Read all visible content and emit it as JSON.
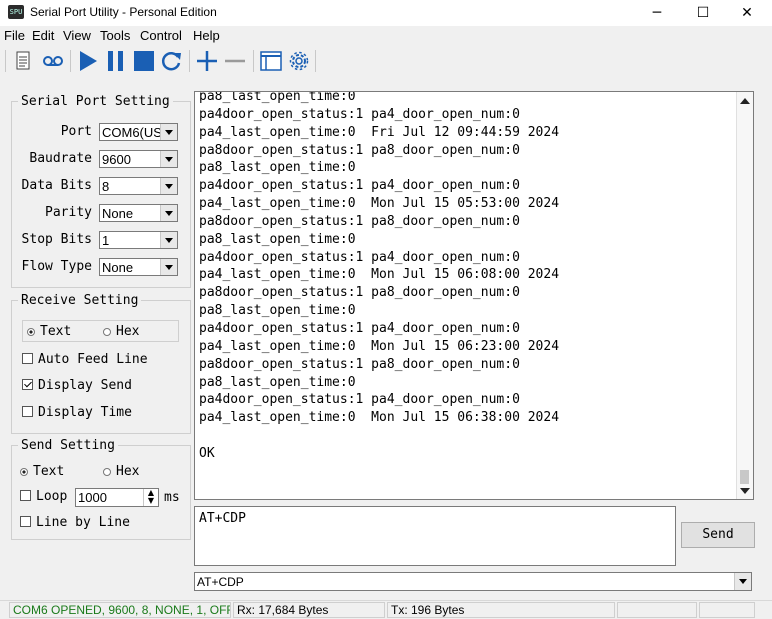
{
  "window": {
    "title": "Serial Port Utility - Personal Edition",
    "icon_text": "SPU"
  },
  "menu": [
    "File",
    "Edit",
    "View",
    "Tools",
    "Control",
    "Help"
  ],
  "serial": {
    "title": "Serial Port Setting",
    "port_label": "Port",
    "port_value": "COM6(USE",
    "baud_label": "Baudrate",
    "baud_value": "9600",
    "databits_label": "Data Bits",
    "databits_value": "8",
    "parity_label": "Parity",
    "parity_value": "None",
    "stopbits_label": "Stop Bits",
    "stopbits_value": "1",
    "flow_label": "Flow Type",
    "flow_value": "None"
  },
  "receive": {
    "title": "Receive Setting",
    "text_label": "Text",
    "hex_label": "Hex",
    "selected": "Text",
    "auto_feed_label": "Auto Feed Line",
    "auto_feed": false,
    "display_send_label": "Display Send",
    "display_send": true,
    "display_time_label": "Display Time",
    "display_time": false
  },
  "send_setting": {
    "title": "Send Setting",
    "text_label": "Text",
    "hex_label": "Hex",
    "selected": "Text",
    "loop_label": "Loop",
    "loop_checked": false,
    "loop_value": "1000",
    "loop_unit": "ms",
    "line_by_line_label": "Line by Line",
    "line_by_line": false
  },
  "log_lines": [
    "pa8_last_open_time:0",
    "pa4door_open_status:1 pa4_door_open_num:0",
    "pa4_last_open_time:0  Fri Jul 12 09:44:59 2024",
    "pa8door_open_status:1 pa8_door_open_num:0",
    "pa8_last_open_time:0",
    "pa4door_open_status:1 pa4_door_open_num:0",
    "pa4_last_open_time:0  Mon Jul 15 05:53:00 2024",
    "pa8door_open_status:1 pa8_door_open_num:0",
    "pa8_last_open_time:0",
    "pa4door_open_status:1 pa4_door_open_num:0",
    "pa4_last_open_time:0  Mon Jul 15 06:08:00 2024",
    "pa8door_open_status:1 pa8_door_open_num:0",
    "pa8_last_open_time:0",
    "pa4door_open_status:1 pa4_door_open_num:0",
    "pa4_last_open_time:0  Mon Jul 15 06:23:00 2024",
    "pa8door_open_status:1 pa8_door_open_num:0",
    "pa8_last_open_time:0",
    "pa4door_open_status:1 pa4_door_open_num:0",
    "pa4_last_open_time:0  Mon Jul 15 06:38:00 2024",
    "",
    "OK"
  ],
  "send_input": "AT+CDP",
  "send_button": "Send",
  "history_value": "AT+CDP",
  "status": {
    "connection": "COM6 OPENED, 9600, 8, NONE, 1, OFF",
    "rx": "Rx: 17,684 Bytes",
    "tx": "Tx: 196 Bytes",
    "connection_color": "#1a7a1a"
  },
  "icons": [
    "document-icon",
    "voicemail-icon",
    "play-icon",
    "pause-icon",
    "stop-icon",
    "refresh-icon",
    "plus-icon",
    "minus-icon",
    "window-icon",
    "gear-icon"
  ]
}
